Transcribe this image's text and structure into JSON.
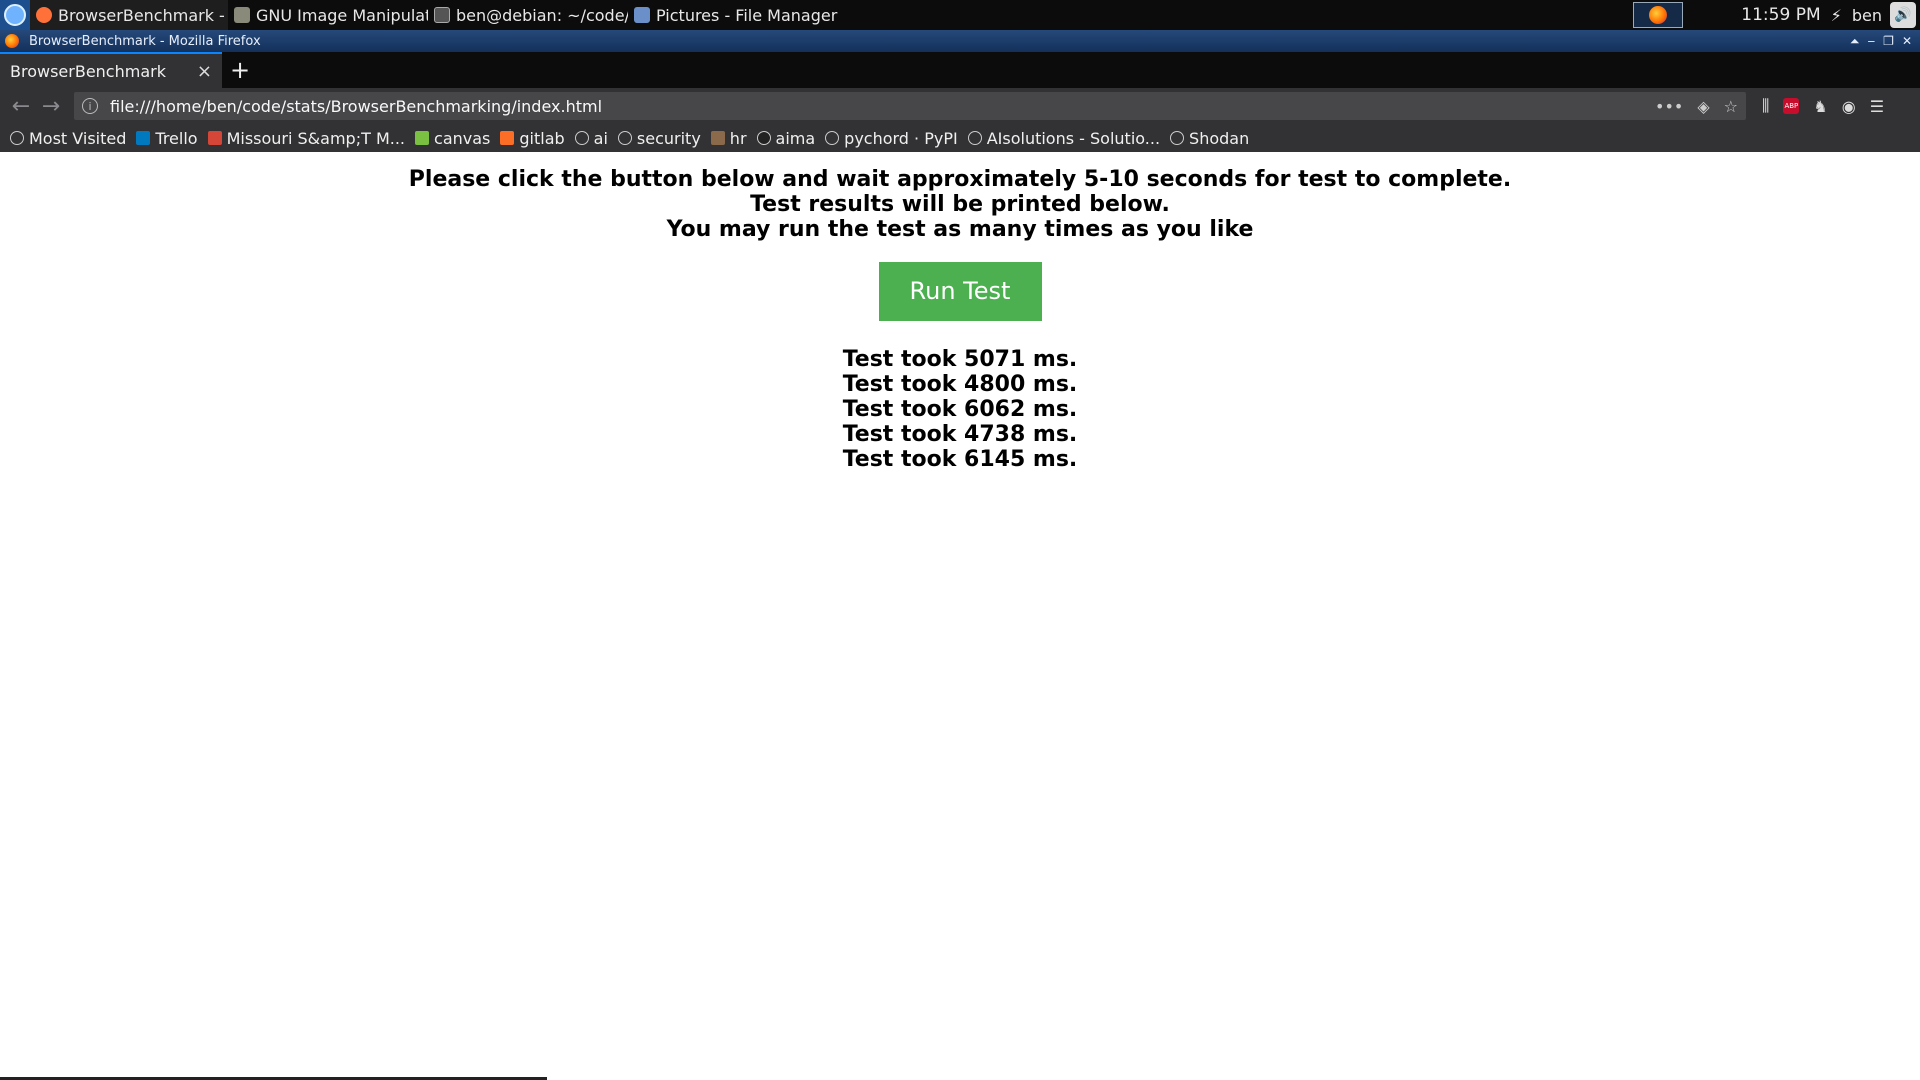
{
  "taskbar": {
    "tasks": [
      {
        "label": "BrowserBenchmark - ...",
        "icon": "firefox-icon",
        "color": "#ff7139"
      },
      {
        "label": "GNU Image Manipulat...",
        "icon": "gimp-icon",
        "color": "#8a8a7a"
      },
      {
        "label": "ben@debian: ~/code/...",
        "icon": "terminal-icon",
        "color": "#555555"
      },
      {
        "label": "Pictures - File Manager",
        "icon": "folder-icon",
        "color": "#6a8fc9"
      }
    ],
    "clock": "11:59 PM",
    "user": "ben"
  },
  "window": {
    "title": "BrowserBenchmark - Mozilla Firefox"
  },
  "browser": {
    "tab_title": "BrowserBenchmark",
    "url": "file:///home/ben/code/stats/BrowserBenchmarking/index.html",
    "bookmarks": [
      {
        "label": "Most Visited",
        "icon": "gear-icon"
      },
      {
        "label": "Trello",
        "icon": "trello-icon"
      },
      {
        "label": "Missouri S&amp;T M...",
        "icon": "gmail-icon"
      },
      {
        "label": "canvas",
        "icon": "canvas-icon"
      },
      {
        "label": "gitlab",
        "icon": "gitlab-icon"
      },
      {
        "label": "ai",
        "icon": "globe-icon"
      },
      {
        "label": "security",
        "icon": "globe-icon"
      },
      {
        "label": "hr",
        "icon": "hr-icon"
      },
      {
        "label": "aima",
        "icon": "github-icon"
      },
      {
        "label": "pychord · PyPI",
        "icon": "globe-icon"
      },
      {
        "label": "AIsolutions - Solutio...",
        "icon": "globe-icon"
      },
      {
        "label": "Shodan",
        "icon": "globe-icon"
      }
    ]
  },
  "page": {
    "instructions": [
      "Please click the button below and wait approximately 5-10 seconds for test to complete.",
      "Test results will be printed below.",
      "You may run the test as many times as you like"
    ],
    "run_button": "Run Test",
    "results": [
      "Test took 5071 ms.",
      "Test took 4800 ms.",
      "Test took 6062 ms.",
      "Test took 4738 ms.",
      "Test took 6145 ms."
    ]
  },
  "colors": {
    "button": "#4caf50",
    "browser_chrome": "#323234",
    "taskbar": "#0c0c0c"
  }
}
